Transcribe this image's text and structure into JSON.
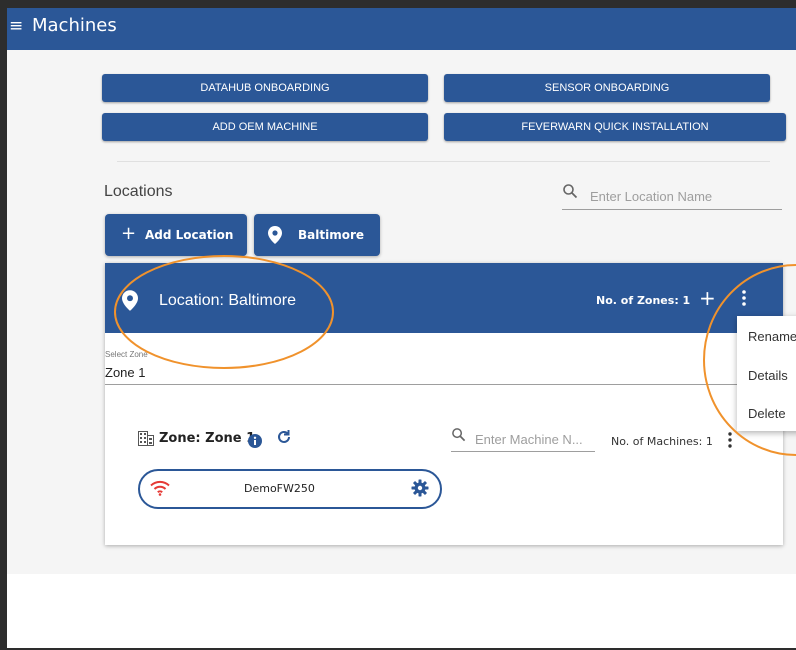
{
  "appbar": {
    "title": "Machines",
    "menu_icon": "menu-icon"
  },
  "buttons": {
    "datahub": "DATAHUB ONBOARDING",
    "sensor": "SENSOR ONBOARDING",
    "oem": "ADD OEM MACHINE",
    "feverwarn": "FEVERWARN QUICK INSTALLATION"
  },
  "locations": {
    "heading": "Locations",
    "search_placeholder": "Enter Location Name",
    "add_location_label": "Add Location",
    "location_tab_label": "Baltimore"
  },
  "location_card": {
    "title": "Location: Baltimore",
    "zones_count": "No. of Zones: 1",
    "select_zone_label": "Select Zone",
    "select_zone_value": "Zone 1"
  },
  "zone": {
    "title": "Zone: Zone 1",
    "machine_search_placeholder": "Enter Machine N...",
    "machines_count": "No. of Machines: 1"
  },
  "machine": {
    "name": "DemoFW250"
  },
  "menu": {
    "items": [
      "Rename",
      "Details",
      "Delete"
    ]
  },
  "colors": {
    "primary": "#2b5797",
    "annotation": "#f0922c",
    "wifi": "#e53935"
  }
}
